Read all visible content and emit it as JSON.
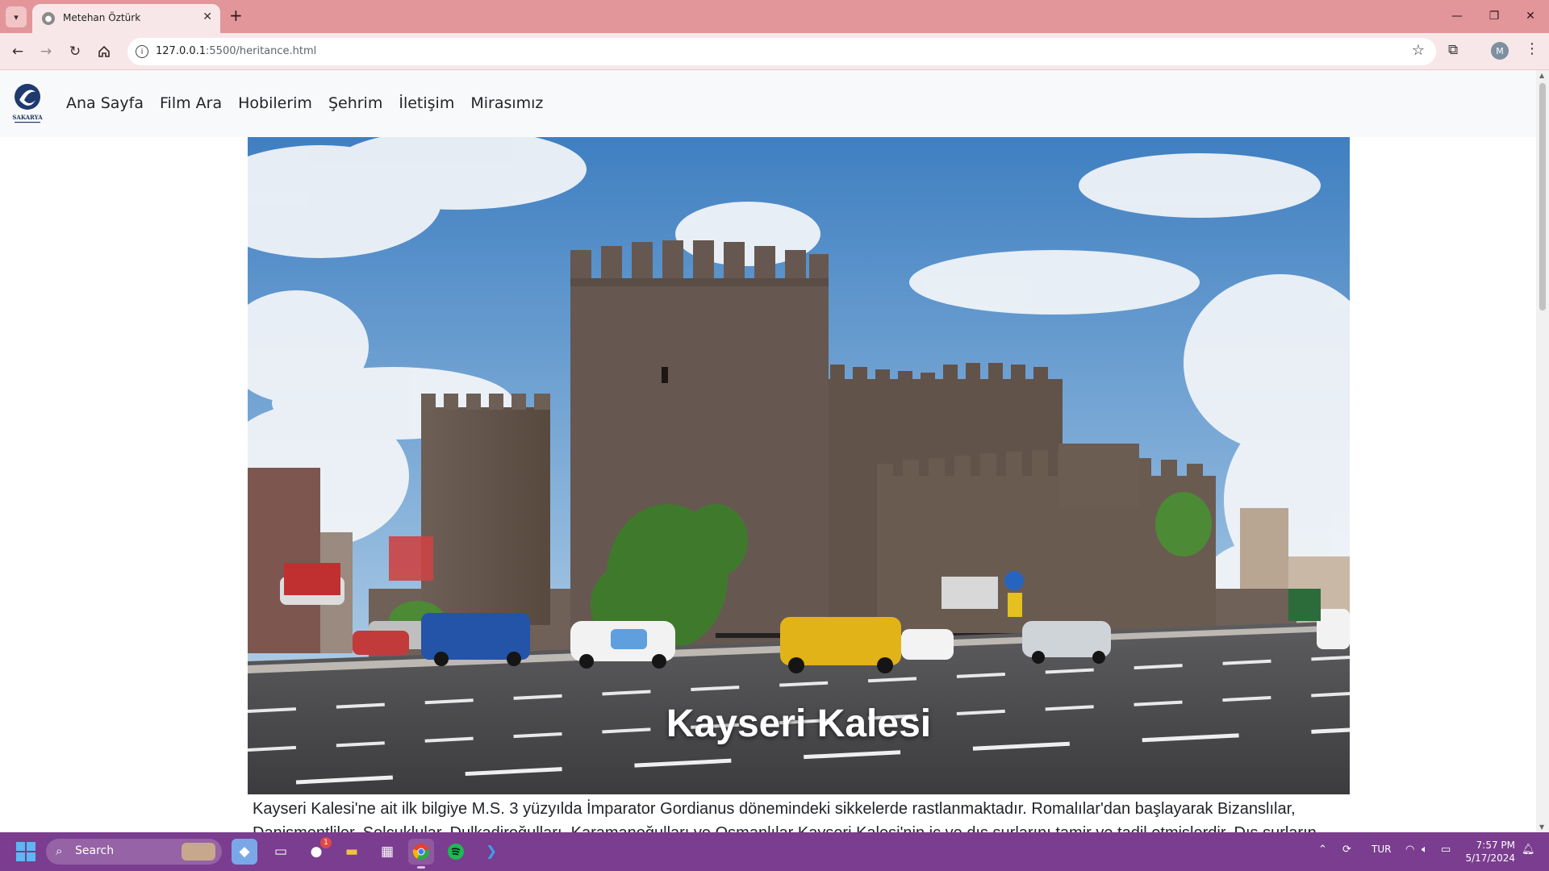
{
  "browser": {
    "tab_title": "Metehan Öztürk",
    "url_host": "127.0.0.1",
    "url_path": ":5500/heritance.html",
    "profile_initial": "M"
  },
  "site": {
    "logo_text": "SAKARYA",
    "nav": [
      {
        "label": "Ana Sayfa"
      },
      {
        "label": "Film Ara"
      },
      {
        "label": "Hobilerim"
      },
      {
        "label": "Şehrim"
      },
      {
        "label": "İletişim"
      },
      {
        "label": "Mirasımız"
      }
    ],
    "hero_caption": "Kayseri Kalesi",
    "article": "Kayseri Kalesi'ne ait ilk bilgiye M.S. 3 yüzyılda İmparator Gordianus dönemindeki sikkelerde rastlanmaktadır. Romalılar'dan başlayarak Bizanslılar, Danişmentliler, Selçuklular, Dulkadiroğulları, Karamanoğulları ve Osmanlılar Kayseri Kalesi'nin iç ve dış surlarını tamir ve tadil etmişlerdir. Dış surların"
  },
  "taskbar": {
    "search_label": "Search",
    "notification_count": "1",
    "language": "TUR",
    "time": "7:57 PM",
    "date": "5/17/2024"
  },
  "colors": {
    "tabbar": "#e3969a",
    "toolbar": "#f8e7e8",
    "taskbar": "#7b3d8f",
    "nav_bg": "#f8f9fa"
  }
}
